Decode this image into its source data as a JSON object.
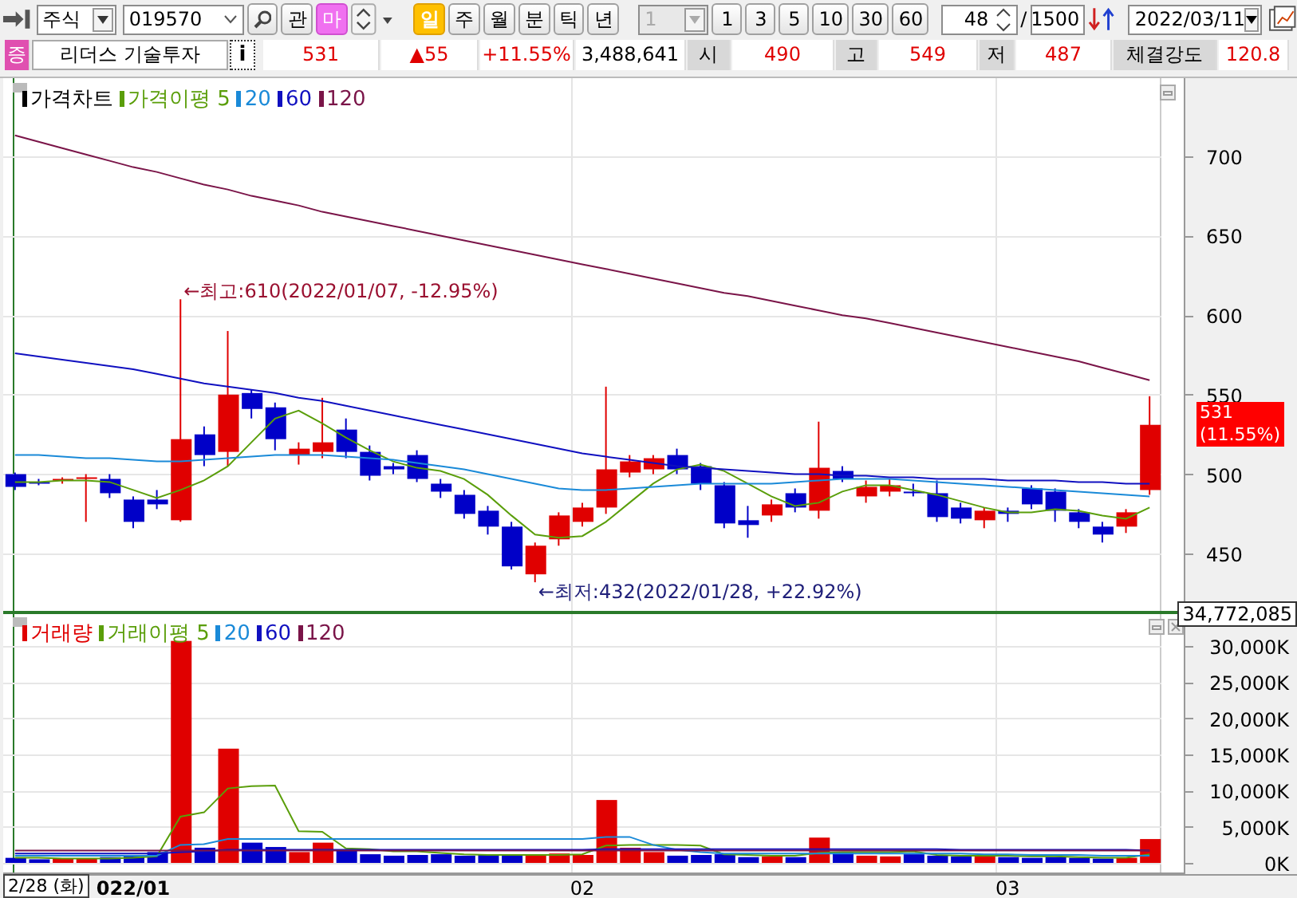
{
  "toolbar": {
    "market_select": "주식",
    "code_field": "019570",
    "action_buttons": [
      {
        "label": "관",
        "kind": "plain"
      },
      {
        "label": "마",
        "kind": "pink"
      }
    ],
    "periods": [
      {
        "label": "일",
        "selected": true
      },
      {
        "label": "주",
        "selected": false
      },
      {
        "label": "월",
        "selected": false
      },
      {
        "label": "분",
        "selected": false
      },
      {
        "label": "틱",
        "selected": false
      },
      {
        "label": "년",
        "selected": false
      }
    ],
    "interval_select": {
      "value": "1",
      "disabled": true
    },
    "intervals": [
      "1",
      "3",
      "5",
      "10",
      "30",
      "60"
    ],
    "count_field": "48",
    "separator": "/",
    "total_field": "1500",
    "date_select": "2022/03/11"
  },
  "quote_bar": {
    "badge": "증",
    "name": "리더스 기술투자",
    "info_button": "i",
    "price": "531",
    "change": "▲55",
    "rate": "+11.55%",
    "volume": "3,488,641",
    "stats": [
      {
        "label": "시",
        "value": "490"
      },
      {
        "label": "고",
        "value": "549"
      },
      {
        "label": "저",
        "value": "487"
      },
      {
        "label": "체결강도",
        "value": "120.8"
      }
    ]
  },
  "price_chart": {
    "legend_title": "가격차트",
    "last_badge": {
      "price": "531",
      "rate": "(11.55%)"
    },
    "chart_data": {
      "type": "candlestick",
      "grid": true,
      "categories": [
        null,
        null,
        null,
        null,
        null,
        null,
        null,
        null,
        null,
        null,
        null,
        null,
        null,
        null,
        null,
        null,
        null,
        null,
        null,
        null,
        null,
        null,
        null,
        null,
        null,
        null,
        null,
        null,
        null,
        null,
        null,
        null,
        null,
        null,
        null,
        null,
        null,
        null,
        null,
        null,
        null,
        null,
        null,
        null,
        null,
        null,
        null,
        null,
        null
      ],
      "ylim": [
        413,
        749
      ],
      "yticks": [
        450,
        500,
        550,
        600,
        650,
        700
      ],
      "ohlc": [
        [
          500,
          501,
          490,
          492
        ],
        [
          495,
          497,
          493,
          494
        ],
        [
          496,
          498,
          494,
          497
        ],
        [
          497,
          500,
          470,
          498
        ],
        [
          497,
          500,
          485,
          488
        ],
        [
          484,
          486,
          466,
          470
        ],
        [
          484,
          490,
          478,
          481
        ],
        [
          471,
          610,
          470,
          522
        ],
        [
          525,
          530,
          505,
          512
        ],
        [
          514,
          590,
          505,
          550
        ],
        [
          551,
          553,
          535,
          541
        ],
        [
          542,
          545,
          515,
          522
        ],
        [
          512,
          520,
          506,
          516
        ],
        [
          514,
          548,
          510,
          520
        ],
        [
          528,
          535,
          510,
          514
        ],
        [
          514,
          518,
          496,
          499
        ],
        [
          505,
          507,
          500,
          503
        ],
        [
          512,
          515,
          495,
          497
        ],
        [
          494,
          497,
          485,
          489
        ],
        [
          487,
          490,
          472,
          475
        ],
        [
          477,
          480,
          462,
          467
        ],
        [
          467,
          470,
          440,
          442
        ],
        [
          437,
          457,
          432,
          455
        ],
        [
          459,
          476,
          455,
          474
        ],
        [
          470,
          482,
          467,
          479
        ],
        [
          479,
          555,
          475,
          503
        ],
        [
          501,
          512,
          498,
          508
        ],
        [
          503,
          512,
          500,
          510
        ],
        [
          512,
          516,
          500,
          503
        ],
        [
          505,
          507,
          490,
          494
        ],
        [
          493,
          495,
          466,
          469
        ],
        [
          471,
          480,
          460,
          468
        ],
        [
          474,
          484,
          470,
          481
        ],
        [
          488,
          491,
          476,
          479
        ],
        [
          477,
          533,
          472,
          504
        ],
        [
          502,
          505,
          495,
          497
        ],
        [
          486,
          496,
          482,
          492
        ],
        [
          489,
          497,
          486,
          493
        ],
        [
          489,
          494,
          486,
          488
        ],
        [
          488,
          496,
          470,
          473
        ],
        [
          479,
          482,
          469,
          472
        ],
        [
          471,
          479,
          466,
          477
        ],
        [
          477,
          479,
          470,
          475
        ],
        [
          491,
          493,
          478,
          481
        ],
        [
          489,
          491,
          470,
          477
        ],
        [
          476,
          478,
          466,
          470
        ],
        [
          467,
          470,
          457,
          462
        ],
        [
          467,
          478,
          463,
          476
        ],
        [
          490,
          549,
          487,
          531
        ]
      ],
      "series": [
        {
          "name": "가격이평 5",
          "type": "line",
          "color": "#5a9e0a",
          "values": [
            495,
            495,
            496,
            496,
            495,
            490,
            485,
            490,
            496,
            505,
            520,
            535,
            540,
            532,
            523,
            515,
            508,
            504,
            502,
            497,
            487,
            474,
            462,
            460,
            461,
            470,
            482,
            494,
            503,
            506,
            502,
            494,
            486,
            480,
            482,
            489,
            493,
            493,
            490,
            487,
            483,
            479,
            476,
            476,
            478,
            477,
            474,
            472,
            479
          ]
        },
        {
          "name": "20",
          "type": "line",
          "color": "#1a8ad8",
          "values": [
            512,
            512,
            511,
            510,
            510,
            509,
            508,
            508,
            509,
            510,
            511,
            512,
            512,
            512,
            511,
            510,
            509,
            507,
            505,
            503,
            500,
            497,
            494,
            491,
            490,
            490,
            491,
            492,
            493,
            494,
            494,
            494,
            494,
            495,
            496,
            497,
            497,
            497,
            496,
            495,
            494,
            493,
            492,
            491,
            490,
            489,
            488,
            487,
            486
          ]
        },
        {
          "name": "60",
          "type": "line",
          "color": "#1010c0",
          "values": [
            576,
            574,
            572,
            570,
            568,
            566,
            563,
            560,
            557,
            555,
            553,
            551,
            548,
            546,
            543,
            540,
            537,
            534,
            531,
            528,
            525,
            522,
            519,
            516,
            513,
            511,
            509,
            507,
            505,
            504,
            503,
            502,
            501,
            500,
            500,
            499,
            499,
            498,
            498,
            497,
            497,
            497,
            496,
            496,
            496,
            495,
            495,
            494,
            494
          ]
        },
        {
          "name": "120",
          "type": "line",
          "color": "#7a1448",
          "values": [
            713,
            709,
            705,
            701,
            697,
            693,
            690,
            686,
            682,
            679,
            675,
            672,
            669,
            665,
            662,
            659,
            656,
            653,
            650,
            647,
            644,
            641,
            638,
            635,
            632,
            629,
            626,
            623,
            620,
            617,
            614,
            612,
            609,
            606,
            603,
            600,
            598,
            595,
            592,
            589,
            586,
            583,
            580,
            577,
            574,
            571,
            567,
            563,
            559
          ]
        }
      ],
      "annotations": [
        "←최고:610(2022/01/07, -12.95%)",
        "←최저:432(2022/01/28, +22.92%)"
      ]
    }
  },
  "volume_chart": {
    "max_label": "34,772,085",
    "chart_data": {
      "type": "bar",
      "grid": true,
      "categories": [
        null,
        null,
        null,
        null,
        null,
        "022/01",
        null,
        null,
        null,
        null,
        null,
        null,
        null,
        null,
        null,
        null,
        null,
        null,
        null,
        null,
        null,
        null,
        null,
        null,
        "02",
        null,
        null,
        null,
        null,
        null,
        null,
        null,
        null,
        null,
        null,
        null,
        null,
        null,
        null,
        null,
        null,
        null,
        "03",
        null,
        null,
        null,
        null,
        null,
        null
      ],
      "ylim": [
        -1544,
        34632
      ],
      "yticks": [
        {
          "value": 0,
          "label": "0K"
        },
        {
          "value": 5000,
          "label": "5,000K"
        },
        {
          "value": 10000,
          "label": "10,000K"
        },
        {
          "value": 15000,
          "label": "15,000K"
        },
        {
          "value": 20000,
          "label": "20,000K"
        },
        {
          "value": 25000,
          "label": "25,000K"
        },
        {
          "value": 30000,
          "label": "30,000K"
        }
      ],
      "series": [
        {
          "name": "거래량",
          "type": "bar",
          "color": "#e00000",
          "values": [
            null,
            null,
            600,
            600,
            null,
            null,
            null,
            30700,
            null,
            15800,
            null,
            null,
            1500,
            2800,
            null,
            null,
            null,
            null,
            null,
            null,
            null,
            null,
            1100,
            1300,
            1100,
            8700,
            2100,
            1500,
            null,
            null,
            null,
            null,
            900,
            null,
            3500,
            null,
            1000,
            900,
            null,
            null,
            null,
            1100,
            null,
            null,
            null,
            null,
            null,
            700,
            3300
          ]
        },
        {
          "type": "bar",
          "color": "#0000c8",
          "values": [
            700,
            500,
            null,
            null,
            800,
            900,
            1500,
            null,
            2100,
            null,
            2800,
            2200,
            null,
            null,
            1700,
            1200,
            1000,
            1100,
            1200,
            1000,
            1100,
            1200,
            null,
            null,
            null,
            null,
            null,
            null,
            1000,
            1100,
            1200,
            800,
            null,
            800,
            null,
            1400,
            null,
            null,
            1200,
            1000,
            900,
            null,
            800,
            700,
            800,
            700,
            600,
            null,
            null
          ]
        },
        {
          "name": "거래이평 5",
          "type": "line",
          "color": "#5a9e0a",
          "values": [
            700,
            700,
            600,
            600,
            600,
            700,
            900,
            6400,
            7000,
            10300,
            10600,
            10700,
            4400,
            4300,
            2000,
            1900,
            1600,
            1600,
            1400,
            1200,
            1100,
            1100,
            1100,
            1100,
            1200,
            2400,
            2500,
            2500,
            2500,
            2400,
            1200,
            1100,
            1000,
            1000,
            1400,
            1500,
            1500,
            1500,
            1600,
            1100,
            1000,
            1000,
            1000,
            900,
            900,
            800,
            700,
            700,
            1200
          ]
        },
        {
          "name": "20",
          "type": "line",
          "color": "#1a8ad8",
          "values": [
            1000,
            1000,
            1000,
            1000,
            1000,
            1000,
            1000,
            2500,
            2600,
            3300,
            3300,
            3300,
            3300,
            3300,
            3300,
            3300,
            3300,
            3300,
            3300,
            3300,
            3300,
            3300,
            3300,
            3300,
            3300,
            3600,
            3600,
            2500,
            1800,
            1500,
            1300,
            1300,
            1300,
            1300,
            1300,
            1300,
            1300,
            1300,
            1300,
            1300,
            1300,
            1200,
            1200,
            1100,
            1100,
            1100,
            1000,
            1000,
            1000
          ]
        },
        {
          "name": "60",
          "type": "line",
          "color": "#1010c0",
          "values": [
            1300,
            1300,
            1300,
            1300,
            1300,
            1300,
            1300,
            1500,
            1600,
            1800,
            1800,
            1800,
            1800,
            1800,
            1800,
            1800,
            1800,
            1800,
            1800,
            1800,
            1800,
            1800,
            1800,
            1800,
            1800,
            1900,
            1900,
            1900,
            1900,
            1900,
            1900,
            1900,
            1900,
            1900,
            1900,
            1900,
            1900,
            1900,
            1900,
            1900,
            1800,
            1800,
            1800,
            1800,
            1800,
            1800,
            1800,
            1800,
            1700
          ]
        },
        {
          "name": "120",
          "type": "line",
          "color": "#7a1448",
          "values": [
            1700,
            1700,
            1700,
            1700,
            1700,
            1700,
            1700,
            1700,
            1700,
            1700,
            1700,
            1700,
            1700,
            1700,
            1700,
            1700,
            1700,
            1700,
            1700,
            1700,
            1700,
            1700,
            1700,
            1700,
            1700,
            1700,
            1700,
            1700,
            1700,
            1700,
            1700,
            1700,
            1700,
            1700,
            1700,
            1700,
            1700,
            1700,
            1700,
            1700,
            1700,
            1700,
            1700,
            1700,
            1700,
            1700,
            1700,
            1700,
            1700
          ]
        }
      ]
    }
  },
  "x_axis": {
    "cursor_date": "2/28 (화)"
  }
}
